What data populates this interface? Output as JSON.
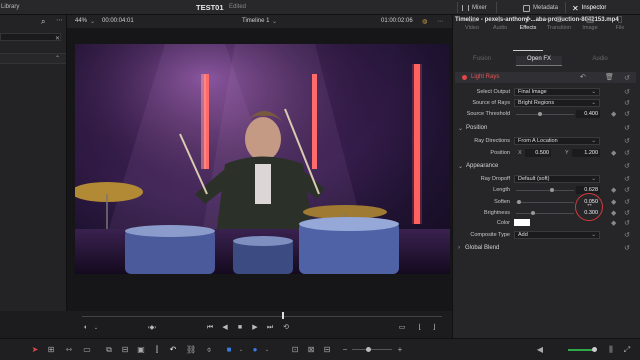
{
  "topbar": {
    "library_label": "Library",
    "project_name": "TEST01",
    "project_status": "Edited",
    "mixer_label": "Mixer",
    "metadata_label": "Metadata",
    "inspector_label": "Inspector"
  },
  "viewer": {
    "zoom": "44%",
    "timecode_left": "00:00:04:01",
    "timeline_name": "Timeline 1",
    "timecode_right": "01:00:02:06"
  },
  "inspector": {
    "title": "Timeline - pexels-anthony-...aba-production-8042153.mp4",
    "tabs": [
      {
        "label": "Video",
        "icon": "video-icon",
        "active": false
      },
      {
        "label": "Audio",
        "icon": "audio-icon",
        "active": false
      },
      {
        "label": "Effects",
        "icon": "effects-icon",
        "active": true
      },
      {
        "label": "Transition",
        "icon": "transition-icon",
        "active": false
      },
      {
        "label": "Image",
        "icon": "image-icon",
        "active": false
      },
      {
        "label": "File",
        "icon": "file-icon",
        "active": false
      }
    ],
    "subtabs": [
      "Fusion",
      "Open FX",
      "Audio"
    ],
    "active_subtab": "Open FX",
    "effect_name": "Light Rays",
    "select_output_label": "Select Output",
    "select_output_value": "Final Image",
    "source_of_rays_label": "Source of Rays",
    "source_of_rays_value": "Bright Regions",
    "source_threshold_label": "Source Threshold",
    "source_threshold_value": "0.400",
    "position_section": "Position",
    "ray_directions_label": "Ray Directions",
    "ray_directions_value": "From A Location",
    "position_label": "Position",
    "x_label": "X",
    "x_value": "0.500",
    "y_label": "Y",
    "y_value": "1.200",
    "appearance_section": "Appearance",
    "ray_dropoff_label": "Ray Dropoff",
    "ray_dropoff_value": "Default (soft)",
    "length_label": "Length",
    "length_value": "0.628",
    "soften_label": "Soften",
    "soften_value": "0.050",
    "brightness_label": "Brightness",
    "brightness_value": "0.300",
    "color_label": "Color",
    "color_value": "#ffffff",
    "composite_type_label": "Composite Type",
    "composite_type_value": "Add",
    "global_blend_label": "Global Blend"
  },
  "colors": {
    "accent_red": "#e04848",
    "background": "#1c1c1e",
    "panel": "#262629"
  }
}
